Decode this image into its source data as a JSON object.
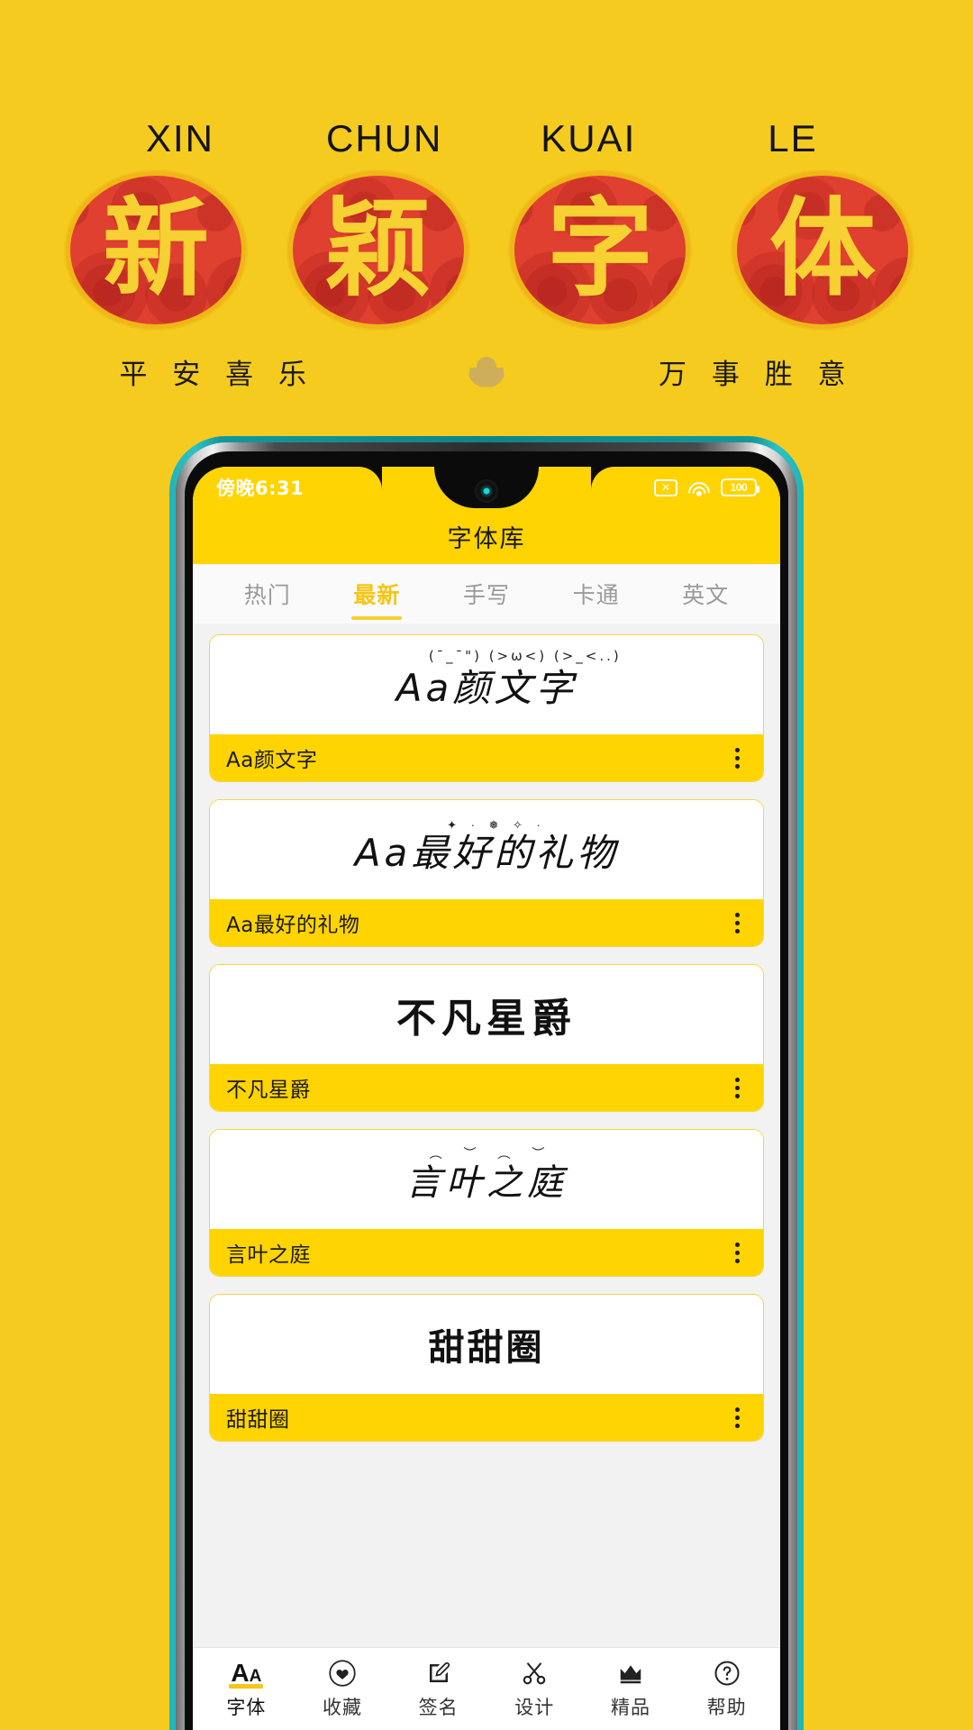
{
  "poster": {
    "background_color": "#f5cb20",
    "pinyin": [
      "XIN",
      "CHUN",
      "KUAI",
      "LE"
    ],
    "seals": [
      {
        "char": "新",
        "color": "#f7d032",
        "bg": "#e0402f"
      },
      {
        "char": "颖",
        "color": "#f7d032",
        "bg": "#e0402f"
      },
      {
        "char": "字",
        "color": "#f7d032",
        "bg": "#e0402f"
      },
      {
        "char": "体",
        "color": "#f7d032",
        "bg": "#e0402f"
      }
    ],
    "wish_left": "平 安 喜 乐",
    "wish_right": "万 事 胜 意",
    "ingot_icon": "gold-ingot-icon"
  },
  "phone": {
    "bezel_color": "#15a0a4",
    "statusbar": {
      "time": "傍晚6:31",
      "icons": {
        "sim": "sim-disabled-icon",
        "sim_glyph": "✕",
        "wifi": "wifi-icon",
        "battery": "battery-icon",
        "battery_level": "100"
      }
    }
  },
  "app": {
    "title": "字体库",
    "accent_color": "#ffd400",
    "tabs": [
      {
        "label": "热门",
        "active": false
      },
      {
        "label": "最新",
        "active": true
      },
      {
        "label": "手写",
        "active": false
      },
      {
        "label": "卡通",
        "active": false
      },
      {
        "label": "英文",
        "active": false
      }
    ],
    "fonts": [
      {
        "preview": "Aa颜文字",
        "name": "Aa颜文字",
        "deco": "(¯_¯\") (>ω<) (>_<..)",
        "deco_type": "kaomoji",
        "style": "handwriting"
      },
      {
        "preview": "Aa最好的礼物",
        "name": "Aa最好的礼物",
        "deco": "✦ · ❅ ✧ ·",
        "deco_type": "dots",
        "style": "handwriting"
      },
      {
        "preview": "不凡星爵",
        "name": "不凡星爵",
        "deco": "",
        "deco_type": "none",
        "style": "slim"
      },
      {
        "preview": "言叶之庭",
        "name": "言叶之庭",
        "deco": "︵ ︶ ︵ ︶",
        "deco_type": "vine",
        "style": "brush"
      },
      {
        "preview": "甜甜圈",
        "name": "甜甜圈",
        "deco": "",
        "deco_type": "none",
        "style": "round"
      }
    ],
    "menu_icon": "kebab-menu-icon",
    "bottom_nav": [
      {
        "label": "字体",
        "icon": "font-aa-icon",
        "active": true
      },
      {
        "label": "收藏",
        "icon": "heart-icon",
        "active": false
      },
      {
        "label": "签名",
        "icon": "signature-pen-icon",
        "active": false
      },
      {
        "label": "设计",
        "icon": "design-scissors-icon",
        "active": false
      },
      {
        "label": "精品",
        "icon": "crown-icon",
        "active": false
      },
      {
        "label": "帮助",
        "icon": "help-question-icon",
        "active": false
      }
    ]
  }
}
